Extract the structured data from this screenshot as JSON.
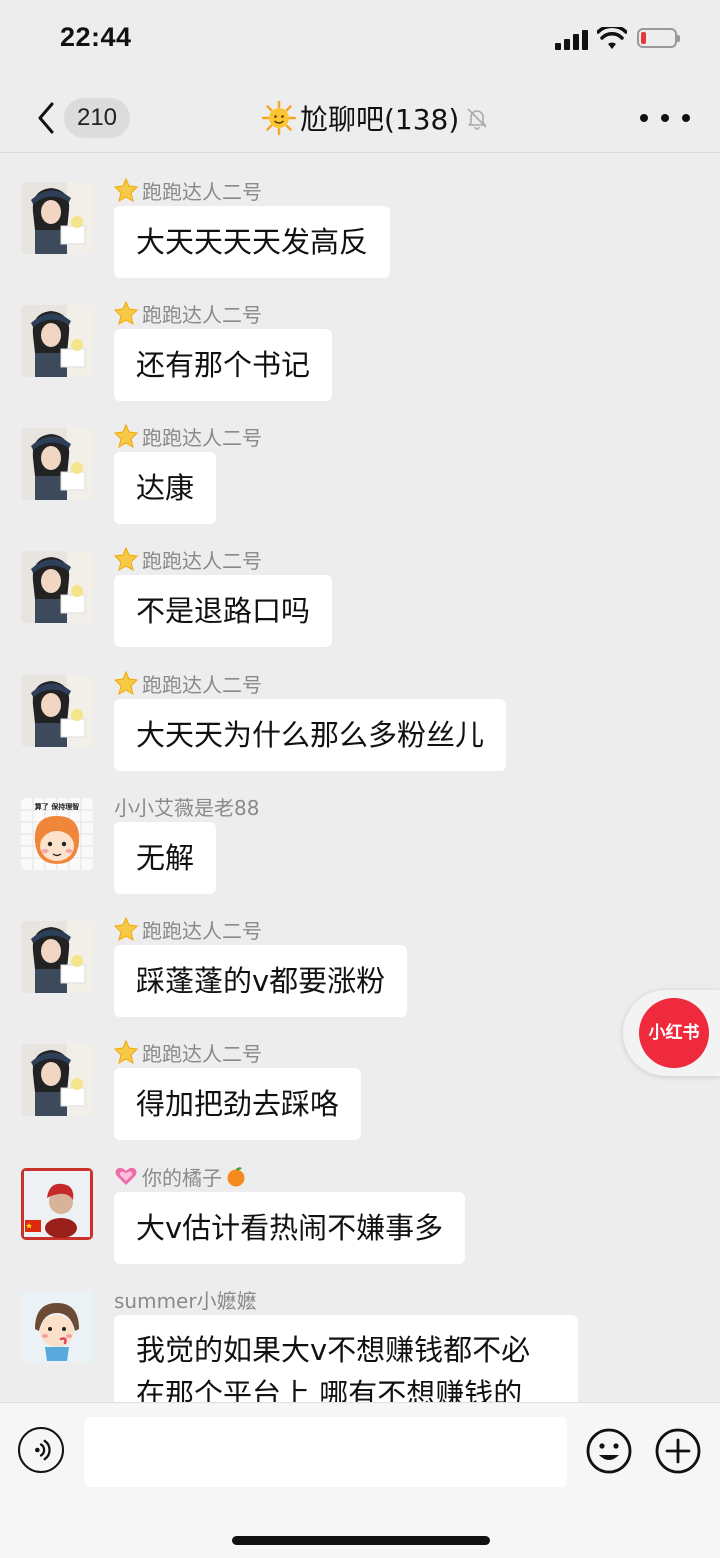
{
  "status": {
    "time": "22:44"
  },
  "header": {
    "back_count": "210",
    "title": "尬聊吧(138)"
  },
  "messages": [
    {
      "sender": "跑跑达人二号",
      "text": "大天天天天发高反"
    },
    {
      "sender": "跑跑达人二号",
      "text": "还有那个书记"
    },
    {
      "sender": "跑跑达人二号",
      "text": "达康"
    },
    {
      "sender": "跑跑达人二号",
      "text": "不是退路口吗"
    },
    {
      "sender": "跑跑达人二号",
      "text": "大天天为什么那么多粉丝儿"
    },
    {
      "sender": "小小艾薇是老88",
      "text": "无解",
      "avatar_text": "算了 保持理智"
    },
    {
      "sender": "跑跑达人二号",
      "text": "踩蓬蓬的v都要涨粉"
    },
    {
      "sender": "跑跑达人二号",
      "text": "得加把劲去踩咯"
    },
    {
      "sender": "你的橘子",
      "text": "大v估计看热闹不嫌事多"
    },
    {
      "sender": "summer小嬷嬷",
      "text": "我觉的如果大v不想赚钱都不必在那个平台上 哪有不想赚钱的 路口"
    }
  ],
  "floating_badge": {
    "label": "小红书"
  },
  "input": {
    "value": "",
    "placeholder": ""
  },
  "colors": {
    "bg": "#ededed",
    "bubble": "#ffffff",
    "badge_red": "#ee2a3c"
  },
  "icons": {
    "back": "chevron-left-icon",
    "mute": "bell-off-icon",
    "more": "more-dots-icon",
    "voice": "voice-icon",
    "emoji": "emoji-icon",
    "plus": "plus-icon"
  }
}
